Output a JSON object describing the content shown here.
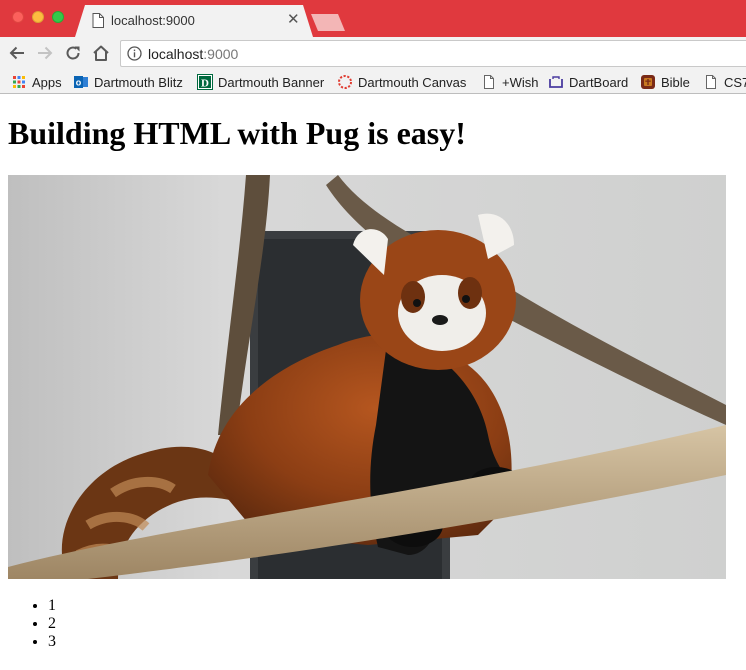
{
  "browser": {
    "tab": {
      "title": "localhost:9000"
    },
    "address": {
      "host": "localhost",
      "port": ":9000"
    },
    "bookmarks": [
      {
        "label": "Apps",
        "icon": "apps-grid-icon"
      },
      {
        "label": "Dartmouth Blitz",
        "icon": "outlook-icon"
      },
      {
        "label": "Dartmouth Banner",
        "icon": "dartmouth-d-icon"
      },
      {
        "label": "Dartmouth Canvas",
        "icon": "canvas-icon"
      },
      {
        "label": "+Wish",
        "icon": "page-icon"
      },
      {
        "label": "DartBoard",
        "icon": "dartboard-icon"
      },
      {
        "label": "Bible",
        "icon": "bible-icon"
      },
      {
        "label": "CS7",
        "icon": "page-icon"
      }
    ]
  },
  "page": {
    "heading": "Building HTML with Pug is easy!",
    "image": {
      "subject": "red-panda-photo"
    },
    "list": [
      "1",
      "2",
      "3"
    ]
  },
  "colors": {
    "tabstrip": "#e0393e",
    "toolbar": "#f2f2f2"
  }
}
